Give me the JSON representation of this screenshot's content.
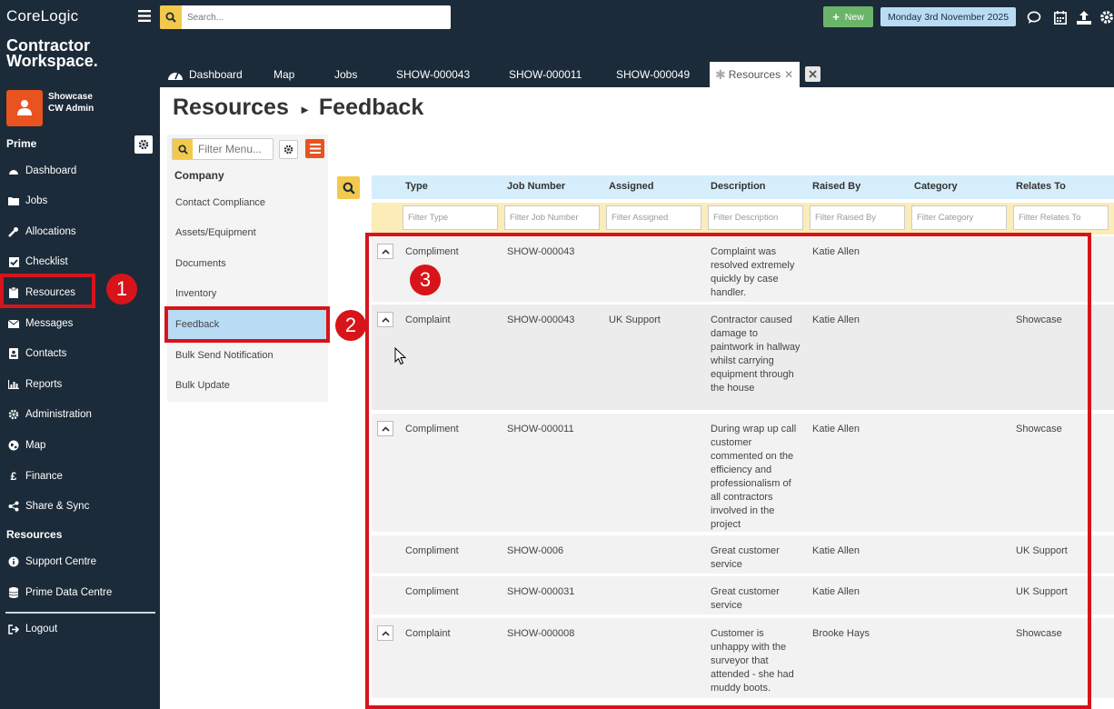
{
  "brand": {
    "logo": "CoreLogic",
    "app_line1": "Contractor",
    "app_line2": "Workspace."
  },
  "user": {
    "line1": "Showcase",
    "line2": "CW Admin"
  },
  "sidebar": {
    "prime_heading": "Prime",
    "resources_heading": "Resources",
    "items": [
      {
        "label": "Dashboard",
        "icon": "dashboard-icon"
      },
      {
        "label": "Jobs",
        "icon": "folder-icon"
      },
      {
        "label": "Allocations",
        "icon": "wrench-icon"
      },
      {
        "label": "Checklist",
        "icon": "checkbox-icon"
      },
      {
        "label": "Resources",
        "icon": "clipboard-icon"
      },
      {
        "label": "Messages",
        "icon": "envelope-icon"
      },
      {
        "label": "Contacts",
        "icon": "contact-card-icon"
      },
      {
        "label": "Reports",
        "icon": "chart-icon"
      },
      {
        "label": "Administration",
        "icon": "gear-icon"
      },
      {
        "label": "Map",
        "icon": "globe-icon"
      },
      {
        "label": "Finance",
        "icon": "pound-icon"
      },
      {
        "label": "Share & Sync",
        "icon": "share-icon"
      }
    ],
    "resource_items": [
      {
        "label": "Support Centre",
        "icon": "info-icon"
      },
      {
        "label": "Prime Data Centre",
        "icon": "database-icon"
      }
    ],
    "logout": "Logout"
  },
  "topbar": {
    "search_placeholder": "Search...",
    "new_label": "New",
    "date": "Monday 3rd November 2025"
  },
  "tabs": [
    "Dashboard",
    "Map",
    "Jobs",
    "SHOW-000043",
    "SHOW-000011",
    "SHOW-000049",
    "Resources"
  ],
  "page": {
    "title": "Resources",
    "subtitle": "Feedback"
  },
  "submenu": {
    "filter_placeholder": "Filter Menu...",
    "heading": "Company",
    "items": [
      "Contact Compliance",
      "Assets/Equipment",
      "Documents",
      "Inventory",
      "Feedback",
      "Bulk Send Notification",
      "Bulk Update"
    ]
  },
  "table": {
    "columns": [
      "Type",
      "Job Number",
      "Assigned",
      "Description",
      "Raised By",
      "Category",
      "Relates To"
    ],
    "filters": [
      "Filter Type",
      "Filter Job Number",
      "Filter Assigned",
      "Filter Description",
      "Filter Raised By",
      "Filter Category",
      "Filter Relates To"
    ],
    "rows": [
      {
        "type": "Compliment",
        "job": "SHOW-000043",
        "assigned": "",
        "description": "Complaint was resolved extremely quickly by case handler.",
        "raised_by": "Katie Allen",
        "category": "",
        "relates_to": ""
      },
      {
        "type": "Complaint",
        "job": "SHOW-000043",
        "assigned": "UK Support",
        "description": "Contractor caused damage to paintwork in hallway whilst carrying equipment through the house",
        "raised_by": "Katie Allen",
        "category": "",
        "relates_to": "Showcase"
      },
      {
        "type": "Compliment",
        "job": "SHOW-000011",
        "assigned": "",
        "description": "During wrap up call customer commented on the efficiency and professionalism of all contractors involved in the project",
        "raised_by": "Katie Allen",
        "category": "",
        "relates_to": "Showcase"
      },
      {
        "type": "Compliment",
        "job": "SHOW-0006",
        "assigned": "",
        "description": "Great customer service",
        "raised_by": "Katie Allen",
        "category": "",
        "relates_to": "UK Support"
      },
      {
        "type": "Compliment",
        "job": "SHOW-000031",
        "assigned": "",
        "description": "Great customer service",
        "raised_by": "Katie Allen",
        "category": "",
        "relates_to": "UK Support"
      },
      {
        "type": "Complaint",
        "job": "SHOW-000008",
        "assigned": "",
        "description": "Customer is unhappy with the surveyor that attended - she had muddy boots.",
        "raised_by": "Brooke Hays",
        "category": "",
        "relates_to": "Showcase"
      }
    ]
  },
  "annotations": [
    "1",
    "2",
    "3"
  ],
  "colors": {
    "sidebar": "#1c2b39",
    "accent_orange": "#e8531f",
    "highlight_red": "#d7141a",
    "selected_blue": "#b9dcf5",
    "filter_yellow": "#fbecb8"
  }
}
